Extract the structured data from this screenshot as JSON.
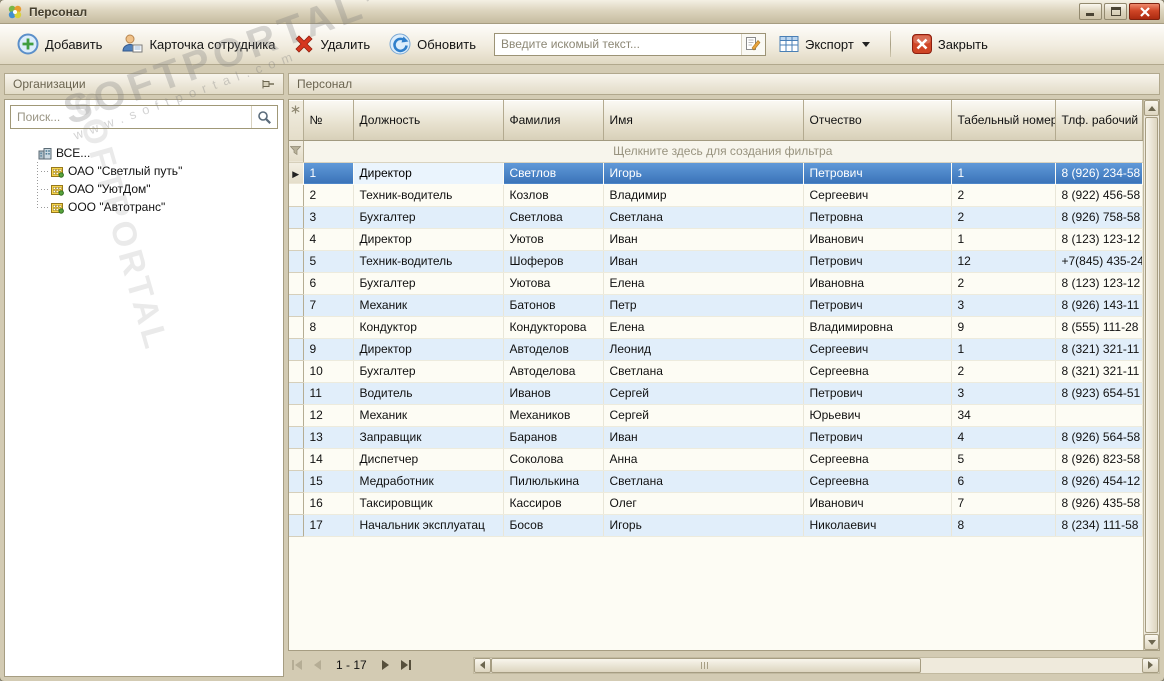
{
  "window": {
    "title": "Персонал"
  },
  "watermark": {
    "brand": "SOFTPORTAL",
    "tm": "TM",
    "url": "www.softportal.com"
  },
  "toolbar": {
    "add": "Добавить",
    "employee_card": "Карточка сотрудника",
    "delete": "Удалить",
    "refresh": "Обновить",
    "search_placeholder": "Введите искомый текст...",
    "export": "Экспорт",
    "close": "Закрыть"
  },
  "sidebar": {
    "title": "Организации",
    "search_placeholder": "Поиск...",
    "tree": [
      {
        "label": "ВСЕ...",
        "type": "all"
      },
      {
        "label": "ОАО \"Светлый путь\"",
        "type": "org"
      },
      {
        "label": "ОАО \"УютДом\"",
        "type": "org"
      },
      {
        "label": "ООО \"Автотранс\"",
        "type": "org"
      }
    ]
  },
  "grid": {
    "panel_title": "Персонал",
    "columns": [
      "№",
      "Должность",
      "Фамилия",
      "Имя",
      "Отчество",
      "Табельный номер",
      "Тлф. рабочий"
    ],
    "filter_hint": "Щелкните здесь для создания фильтра",
    "selected_index": 0,
    "focused_column": 1,
    "rows": [
      [
        "1",
        "Директор",
        "Светлов",
        "Игорь",
        "Петрович",
        "1",
        "8 (926) 234-58"
      ],
      [
        "2",
        "Техник-водитель",
        "Козлов",
        "Владимир",
        "Сергеевич",
        "2",
        "8 (922) 456-58"
      ],
      [
        "3",
        "Бухгалтер",
        "Светлова",
        "Светлана",
        "Петровна",
        "2",
        "8 (926) 758-58"
      ],
      [
        "4",
        "Директор",
        "Уютов",
        "Иван",
        "Иванович",
        "1",
        "8 (123) 123-12"
      ],
      [
        "5",
        "Техник-водитель",
        "Шоферов",
        "Иван",
        "Петрович",
        "12",
        "+7(845) 435-24"
      ],
      [
        "6",
        "Бухгалтер",
        "Уютова",
        "Елена",
        "Ивановна",
        "2",
        "8 (123) 123-12"
      ],
      [
        "7",
        "Механик",
        "Батонов",
        "Петр",
        "Петрович",
        "3",
        "8 (926) 143-11"
      ],
      [
        "8",
        "Кондуктор",
        "Кондукторова",
        "Елена",
        "Владимировна",
        "9",
        "8 (555) 111-28"
      ],
      [
        "9",
        "Директор",
        "Автоделов",
        "Леонид",
        "Сергеевич",
        "1",
        "8 (321) 321-11"
      ],
      [
        "10",
        "Бухгалтер",
        "Автоделова",
        "Светлана",
        "Сергеевна",
        "2",
        "8 (321) 321-11"
      ],
      [
        "11",
        "Водитель",
        "Иванов",
        "Сергей",
        "Петрович",
        "3",
        "8 (923) 654-51"
      ],
      [
        "12",
        "Механик",
        "Механиков",
        "Сергей",
        "Юрьевич",
        "34",
        ""
      ],
      [
        "13",
        "Заправщик",
        "Баранов",
        "Иван",
        "Петрович",
        "4",
        "8 (926) 564-58"
      ],
      [
        "14",
        "Диспетчер",
        "Соколова",
        "Анна",
        "Сергеевна",
        "5",
        "8 (926) 823-58"
      ],
      [
        "15",
        "Медработник",
        "Пилюлькина",
        "Светлана",
        "Сергеевна",
        "6",
        "8 (926) 454-12"
      ],
      [
        "16",
        "Таксировщик",
        "Кассиров",
        "Олег",
        "Иванович",
        "7",
        "8 (926) 435-58"
      ],
      [
        "17",
        "Начальник эксплуатац",
        "Босов",
        "Игорь",
        "Николаевич",
        "8",
        "8 (234) 111-58"
      ]
    ]
  },
  "pager": {
    "label": "1 - 17"
  },
  "colors": {
    "selection_blue": "#3f7ac0",
    "band_blue": "#e1eefa",
    "chrome_beige": "#d3cbb3",
    "close_red": "#c1341f"
  }
}
